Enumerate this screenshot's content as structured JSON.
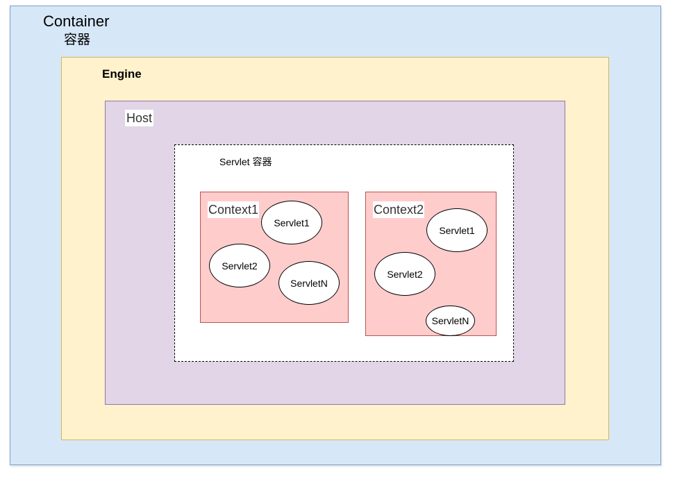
{
  "container": {
    "title": "Container",
    "subtitle": "容器"
  },
  "engine": {
    "title": "Engine"
  },
  "host": {
    "title": "Host"
  },
  "servlet_container": {
    "title": "Servlet 容器"
  },
  "contexts": [
    {
      "title": "Context1",
      "servlets": [
        "Servlet1",
        "Servlet2",
        "ServletN"
      ]
    },
    {
      "title": "Context2",
      "servlets": [
        "Servlet1",
        "Servlet2",
        "ServletN"
      ]
    }
  ],
  "colors": {
    "container_fill": "#d6e7f8",
    "container_border": "#7e9dc6",
    "engine_fill": "#fff2cc",
    "engine_border": "#d6b656",
    "host_fill": "#e1d5e7",
    "host_border": "#9673a6",
    "context_fill": "#ffcccc",
    "context_border": "#b85450"
  }
}
